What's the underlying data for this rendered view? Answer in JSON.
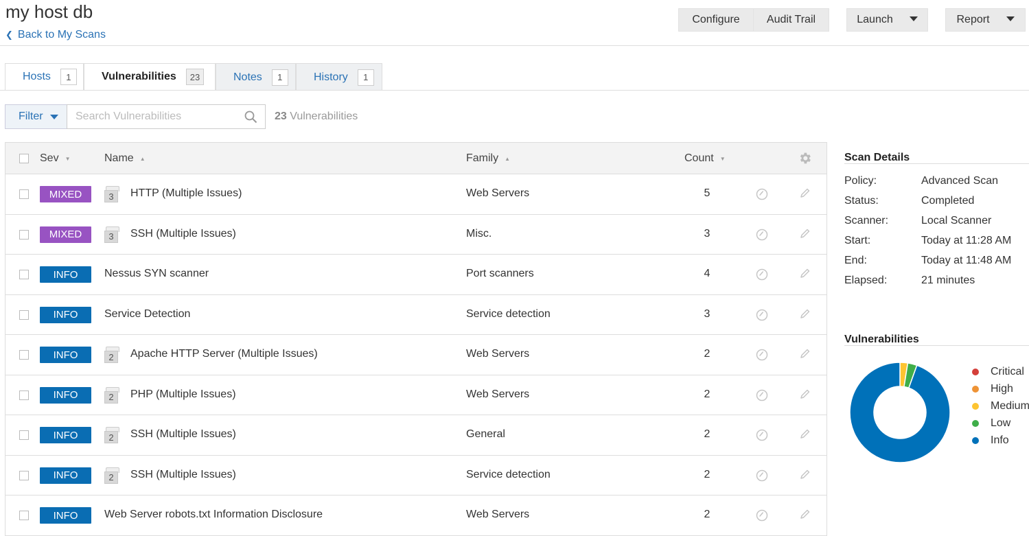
{
  "header": {
    "title": "my host db",
    "back_label": "Back to My Scans",
    "configure": "Configure",
    "audit_trail": "Audit Trail",
    "launch": "Launch",
    "report": "Report"
  },
  "tabs": [
    {
      "label": "Hosts",
      "count": "1"
    },
    {
      "label": "Vulnerabilities",
      "count": "23"
    },
    {
      "label": "Notes",
      "count": "1"
    },
    {
      "label": "History",
      "count": "1"
    }
  ],
  "filter": {
    "label": "Filter",
    "placeholder": "Search Vulnerabilities",
    "count": "23",
    "count_suffix": "Vulnerabilities"
  },
  "table": {
    "headers": {
      "sev": "Sev",
      "name": "Name",
      "family": "Family",
      "count": "Count"
    },
    "rows": [
      {
        "sev": "MIXED",
        "group": "3",
        "name": "HTTP (Multiple Issues)",
        "family": "Web Servers",
        "count": "5"
      },
      {
        "sev": "MIXED",
        "group": "3",
        "name": "SSH (Multiple Issues)",
        "family": "Misc.",
        "count": "3"
      },
      {
        "sev": "INFO",
        "group": "",
        "name": "Nessus SYN scanner",
        "family": "Port scanners",
        "count": "4"
      },
      {
        "sev": "INFO",
        "group": "",
        "name": "Service Detection",
        "family": "Service detection",
        "count": "3"
      },
      {
        "sev": "INFO",
        "group": "2",
        "name": "Apache HTTP Server (Multiple Issues)",
        "family": "Web Servers",
        "count": "2"
      },
      {
        "sev": "INFO",
        "group": "2",
        "name": "PHP (Multiple Issues)",
        "family": "Web Servers",
        "count": "2"
      },
      {
        "sev": "INFO",
        "group": "2",
        "name": "SSH (Multiple Issues)",
        "family": "General",
        "count": "2"
      },
      {
        "sev": "INFO",
        "group": "2",
        "name": "SSH (Multiple Issues)",
        "family": "Service detection",
        "count": "2"
      },
      {
        "sev": "INFO",
        "group": "",
        "name": "Web Server robots.txt Information Disclosure",
        "family": "Web Servers",
        "count": "2"
      }
    ]
  },
  "scan_details": {
    "title": "Scan Details",
    "items": [
      {
        "key": "Policy:",
        "value": "Advanced Scan"
      },
      {
        "key": "Status:",
        "value": "Completed"
      },
      {
        "key": "Scanner:",
        "value": "Local Scanner"
      },
      {
        "key": "Start:",
        "value": "Today at 11:28 AM"
      },
      {
        "key": "End:",
        "value": "Today at 11:48 AM"
      },
      {
        "key": "Elapsed:",
        "value": "21 minutes"
      }
    ]
  },
  "vulnerabilities_panel": {
    "title": "Vulnerabilities",
    "legend": [
      {
        "label": "Critical",
        "color": "#d43f3a",
        "share": 0
      },
      {
        "label": "High",
        "color": "#ee9336",
        "share": 0
      },
      {
        "label": "Medium",
        "color": "#fdc431",
        "share": 0.025
      },
      {
        "label": "Low",
        "color": "#3fae49",
        "share": 0.03
      },
      {
        "label": "Info",
        "color": "#0071b9",
        "share": 0.945
      }
    ]
  },
  "colors": {
    "link": "#2a72b5",
    "mixed": "#9853c2",
    "info": "#0a6db3"
  }
}
